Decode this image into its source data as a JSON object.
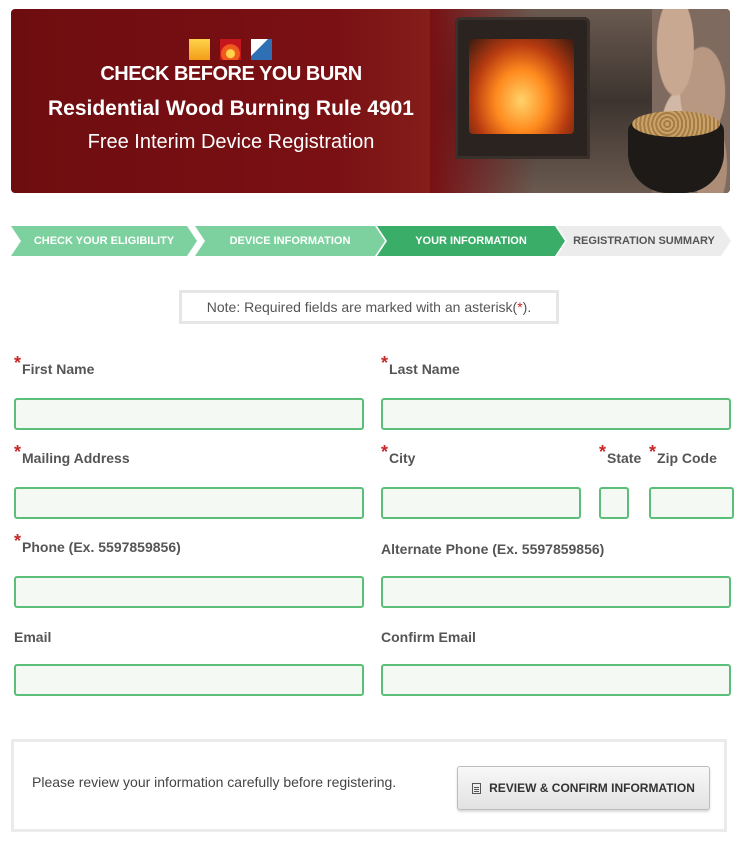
{
  "banner": {
    "title_line1": "CHECK BEFORE YOU BURN",
    "title_line2": "Residential Wood Burning Rule 4901",
    "title_line3": "Free Interim Device Registration",
    "icons": [
      "sun-icon",
      "fire-icon",
      "blue-check-icon"
    ]
  },
  "steps": [
    {
      "label": "Check Your Eligibility",
      "state": "done"
    },
    {
      "label": "Device Information",
      "state": "done"
    },
    {
      "label": "Your Information",
      "state": "active"
    },
    {
      "label": "Registration Summary",
      "state": "todo"
    }
  ],
  "note": {
    "before": "Note: Required fields are marked with an asterisk(",
    "mark": "*",
    "after": ")."
  },
  "form": {
    "first_name": {
      "label": "First Name",
      "value": ""
    },
    "last_name": {
      "label": "Last Name",
      "value": ""
    },
    "mailing_address": {
      "label": "Mailing Address",
      "value": ""
    },
    "city": {
      "label": "City",
      "value": ""
    },
    "state": {
      "label": "State",
      "value": ""
    },
    "zip": {
      "label": "Zip Code",
      "value": ""
    },
    "phone": {
      "label": "Phone (Ex. 5597859856)",
      "value": ""
    },
    "alt_phone": {
      "label": "Alternate Phone (Ex. 5597859856)",
      "value": ""
    },
    "email": {
      "label": "Email",
      "value": ""
    },
    "confirm_email": {
      "label": "Confirm Email",
      "value": ""
    },
    "required_mark": "*"
  },
  "footer": {
    "message": "Please review your information carefully before registering.",
    "button_label": "Review & Confirm Information"
  },
  "colors": {
    "banner_red": "#7a1014",
    "step_done": "#7dd19e",
    "step_active": "#3aae68",
    "step_todo": "#ececec",
    "input_border": "#5bbf7a",
    "required_star": "#c62828"
  }
}
